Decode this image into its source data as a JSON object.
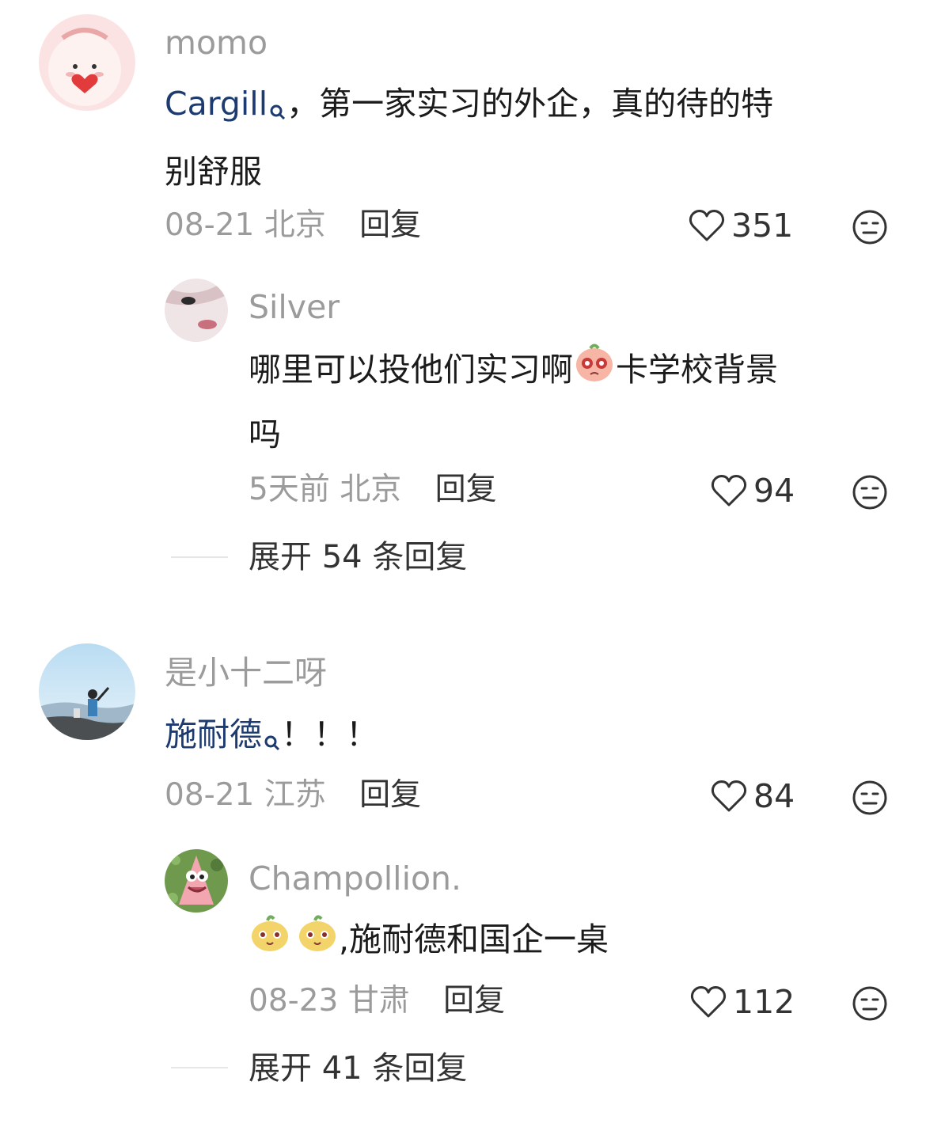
{
  "comments": [
    {
      "username": "momo",
      "link_text": "Cargill",
      "text_line1": "，第一家实习的外企，真的待的特",
      "text_line2": "别舒服",
      "date": "08-21",
      "location": "北京",
      "reply_label": "回复",
      "likes": "351",
      "replies": [
        {
          "username": "Silver",
          "text_part1": "哪里可以投他们实习啊",
          "text_part2": "卡学校背景",
          "text_line2": "吗",
          "date": "5天前",
          "location": "北京",
          "reply_label": "回复",
          "likes": "94"
        }
      ],
      "expand_label": "展开 54 条回复"
    },
    {
      "username": "是小十二呀",
      "link_text": "施耐德",
      "text_suffix": "！！！",
      "date": "08-21",
      "location": "江苏",
      "reply_label": "回复",
      "likes": "84",
      "replies": [
        {
          "username": "Champollion.",
          "text": ",施耐德和国企一桌",
          "date": "08-23",
          "location": "甘肃",
          "reply_label": "回复",
          "likes": "112"
        }
      ],
      "expand_label": "展开 41 条回复"
    }
  ],
  "icons": {
    "like": "heart-outline-icon",
    "dislike": "neutral-face-icon",
    "search": "search-icon"
  },
  "colors": {
    "link": "#1d3b70",
    "muted": "#9b9b9b",
    "text": "#1b1b1b"
  }
}
